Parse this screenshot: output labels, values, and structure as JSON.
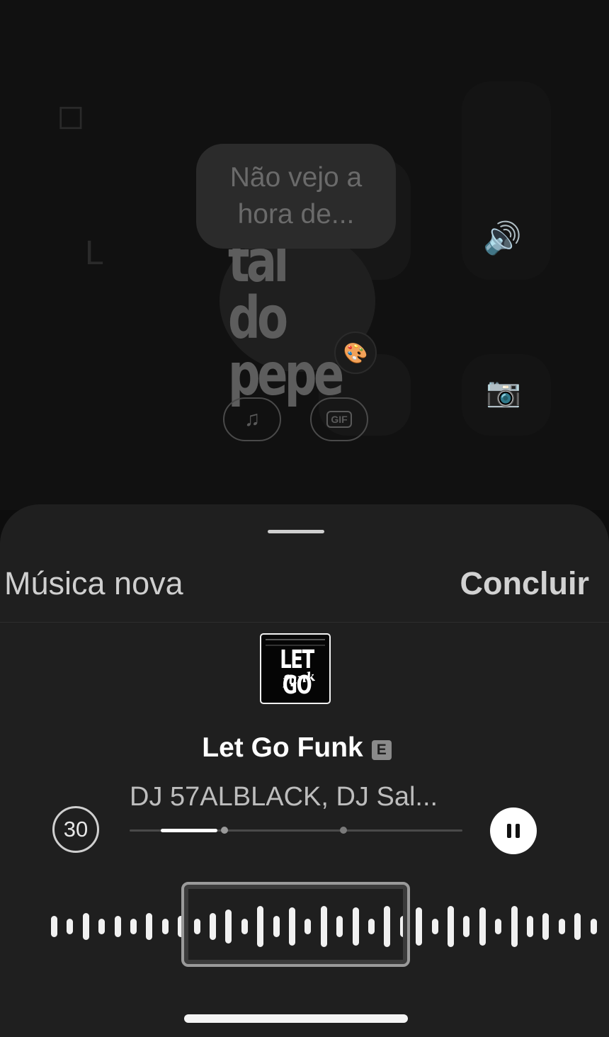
{
  "background": {
    "prompt_text": "Não vejo a hora de...",
    "sticker_line1": "tal do",
    "sticker_line2": "pepe",
    "music_tool_icon": "music-note-icon",
    "gif_tool_label": "GIF",
    "palette_icon": "palette-icon"
  },
  "sheet": {
    "new_music_label": "Música nova",
    "done_label": "Concluir"
  },
  "track": {
    "cover_title": "LET GO",
    "cover_subtitle": "funk",
    "title": "Let Go Funk",
    "explicit_badge": "E",
    "artist": "DJ 57ALBLACK, DJ Sal...",
    "duration": "30",
    "progress_fraction": 0.17
  },
  "waveform": {
    "heights": [
      30,
      22,
      38,
      22,
      30,
      22,
      38,
      22,
      30,
      22,
      38,
      48,
      22,
      58,
      30,
      54,
      22,
      58,
      30,
      54,
      22,
      58,
      30,
      54,
      22,
      58,
      30,
      54,
      22,
      58,
      30,
      38,
      22,
      38,
      22,
      30,
      22,
      38,
      22,
      30,
      22,
      38,
      22,
      30,
      22,
      38,
      22,
      30,
      22,
      38
    ]
  },
  "colors": {
    "sheet_bg": "#1f1f1f",
    "accent": "#ffffff"
  }
}
